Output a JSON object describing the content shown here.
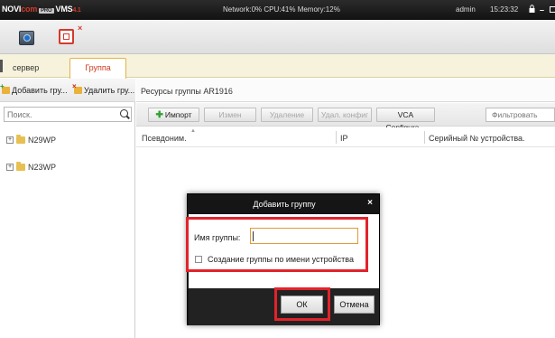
{
  "titlebar": {
    "brand_novi": "NOVI",
    "brand_com": "com",
    "brand_pro": "PRO",
    "brand_vms": "VMS",
    "brand_version": "4.1",
    "system_info": "Network:0% CPU:41% Memory:12%",
    "user": "admin",
    "time": "15:23:32"
  },
  "tabs": {
    "server": "сервер",
    "group": "Группа"
  },
  "left_panel": {
    "add_group": "Добавить гру...",
    "delete_group": "Удалить гру...",
    "search_placeholder": "Поиск.",
    "tree": [
      {
        "label": "N29WP"
      },
      {
        "label": "N23WP"
      }
    ]
  },
  "right_panel": {
    "title": "Ресурсы группы AR1916",
    "buttons": {
      "import": "Импорт",
      "edit": "Измен",
      "delete": "Удаление",
      "delete_config": "Удал. конфиг",
      "vca_config": "VCA Configura..."
    },
    "filter_placeholder": "Фильтровать",
    "columns": {
      "alias": "Псевдоним.",
      "ip": "IP",
      "serial": "Серийный № устройства."
    }
  },
  "dialog": {
    "title": "Добавить группу",
    "name_label": "Имя группы:",
    "name_value": "",
    "checkbox_label": "Создание группы по имени устройства",
    "ok": "ОК",
    "cancel": "Отмена"
  },
  "colors": {
    "highlight_red": "#e2232b",
    "tab_active_text": "#d0381f",
    "dialog_header": "#151515"
  }
}
